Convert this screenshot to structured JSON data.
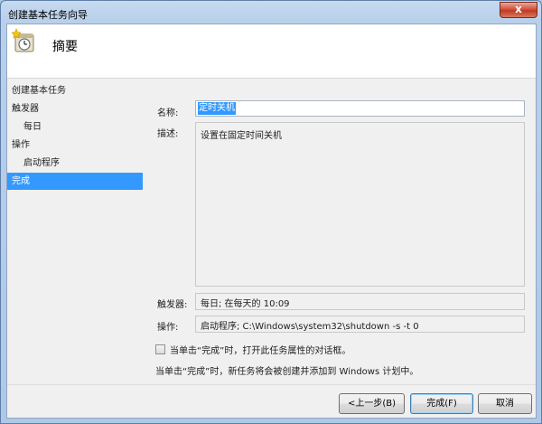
{
  "window": {
    "title": "创建基本任务向导",
    "close_glyph": "x"
  },
  "header": {
    "title": "摘要",
    "icon": "task-clock-icon"
  },
  "nav": {
    "items": [
      {
        "label": "创建基本任务",
        "level": 0,
        "selected": false
      },
      {
        "label": "触发器",
        "level": 0,
        "selected": false
      },
      {
        "label": "每日",
        "level": 1,
        "selected": false
      },
      {
        "label": "操作",
        "level": 0,
        "selected": false
      },
      {
        "label": "启动程序",
        "level": 1,
        "selected": false
      },
      {
        "label": "完成",
        "level": 0,
        "selected": true
      }
    ]
  },
  "summary": {
    "name_label": "名称:",
    "name_value": "定时关机",
    "desc_label": "描述:",
    "desc_value": "设置在固定时间关机",
    "trigger_label": "触发器:",
    "trigger_value": "每日; 在每天的 10:09",
    "action_label": "操作:",
    "action_value": "启动程序; C:\\Windows\\system32\\shutdown -s -t 0"
  },
  "options": {
    "checkbox_checked": false,
    "checkbox_label": "当单击“完成”时，打开此任务属性的对话框。",
    "info_text": "当单击“完成”时，新任务将会被创建并添加到 Windows 计划中。"
  },
  "buttons": {
    "back": "<上一步(B)",
    "finish": "完成(F)",
    "cancel": "取消"
  },
  "colors": {
    "selection": "#3399ff",
    "close_button": "#c03a22",
    "frame": "#aec8e6"
  }
}
